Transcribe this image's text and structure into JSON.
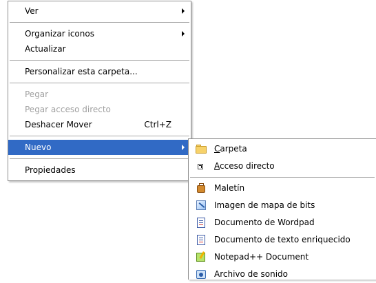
{
  "context_menu": {
    "items": [
      {
        "label": "Ver",
        "has_submenu": true
      },
      {
        "label": "Organizar iconos",
        "has_submenu": true
      },
      {
        "label": "Actualizar"
      },
      {
        "label": "Personalizar esta carpeta..."
      },
      {
        "label": "Pegar",
        "disabled": true
      },
      {
        "label": "Pegar acceso directo",
        "disabled": true
      },
      {
        "label": "Deshacer Mover",
        "shortcut": "Ctrl+Z"
      },
      {
        "label": "Nuevo",
        "has_submenu": true,
        "selected": true
      },
      {
        "label": "Propiedades"
      }
    ]
  },
  "new_submenu": {
    "items": [
      {
        "label": "Carpeta",
        "icon": "folder-icon"
      },
      {
        "label": "Acceso directo",
        "icon": "shortcut-icon"
      },
      {
        "label": "Maletín",
        "icon": "briefcase-icon"
      },
      {
        "label": "Imagen de mapa de bits",
        "icon": "bitmap-image-icon"
      },
      {
        "label": "Documento de Wordpad",
        "icon": "wordpad-document-icon"
      },
      {
        "label": "Documento de texto enriquecido",
        "icon": "rich-text-document-icon"
      },
      {
        "label": "Notepad++ Document",
        "icon": "notepadpp-document-icon"
      },
      {
        "label": "Archivo de sonido",
        "icon": "sound-file-icon"
      }
    ]
  },
  "colors": {
    "selection": "#316ac5",
    "disabled_text": "#a0a0a0",
    "menu_border": "#8c8c8c"
  }
}
